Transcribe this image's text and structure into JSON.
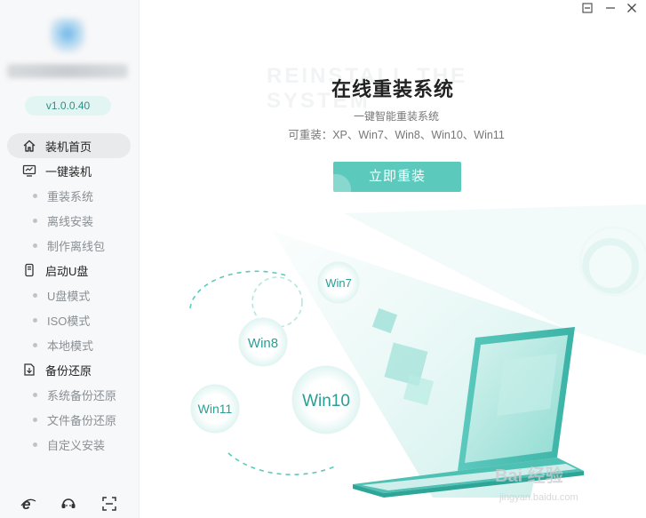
{
  "sidebar": {
    "version": "v1.0.0.40",
    "menu": [
      {
        "label": "装机首页",
        "icon": "home-icon"
      },
      {
        "label": "一键装机",
        "icon": "monitor-icon"
      },
      {
        "label": "重装系统"
      },
      {
        "label": "离线安装"
      },
      {
        "label": "制作离线包"
      },
      {
        "label": "启动U盘",
        "icon": "usb-icon"
      },
      {
        "label": "U盘模式"
      },
      {
        "label": "ISO模式"
      },
      {
        "label": "本地模式"
      },
      {
        "label": "备份还原",
        "icon": "backup-icon"
      },
      {
        "label": "系统备份还原"
      },
      {
        "label": "文件备份还原"
      },
      {
        "label": "自定义安装"
      }
    ],
    "bottom_icons": [
      "browser-e-icon",
      "support-chat-icon",
      "screenshot-icon"
    ]
  },
  "window": {
    "buttons": [
      "minimize-icon",
      "close-icon"
    ]
  },
  "main": {
    "bg_text": "REINSTALL THE SYSTEM",
    "title": "在线重装系统",
    "subtitle": "一键智能重装系统",
    "systems": "可重装：XP、Win7、Win8、Win10、Win11",
    "cta_label": "立即重装"
  },
  "bubbles": {
    "win7": "Win7",
    "win8": "Win8",
    "win10": "Win10",
    "win11": "Win11"
  },
  "watermark": {
    "brand": "Bai 经验",
    "url": "jingyan.baidu.com"
  },
  "colors": {
    "accent": "#5cc9bd",
    "accent_dark": "#2a9e92"
  }
}
